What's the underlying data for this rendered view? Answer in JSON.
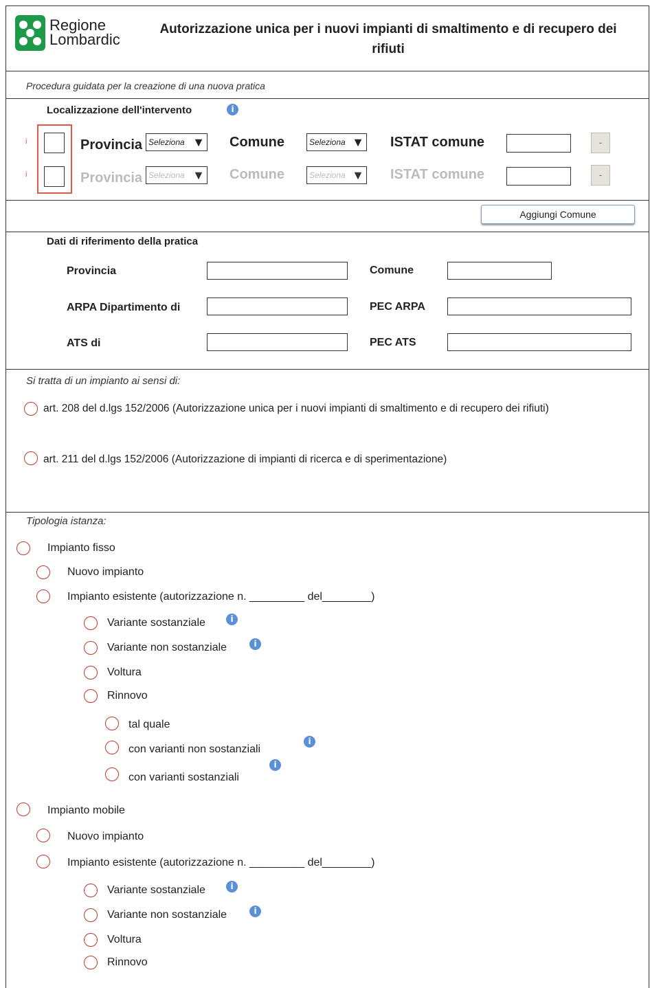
{
  "header": {
    "logo_line1": "Regione",
    "logo_line2": "Lombardic",
    "title_line1": "Autorizzazione unica per i nuovi impianti di smaltimento e di recupero dei",
    "title_line2": "rifiuti"
  },
  "subtitle": "Procedura guidata per la creazione di una nuova pratica",
  "localizzazione": {
    "heading": "Localizzazione dell'intervento",
    "info_icon": "i",
    "rows": [
      {
        "marker": "i",
        "provincia_label": "Provincia",
        "provincia_select": "Seleziona",
        "comune_label": "Comune",
        "comune_select": "Seleziona",
        "istat_label": "ISTAT comune",
        "remove": "-"
      },
      {
        "marker": "i",
        "provincia_label": "Provincia",
        "provincia_select": "Seleziona",
        "comune_label": "Comune",
        "comune_select": "Seleziona",
        "istat_label": "ISTAT comune",
        "remove": "-"
      }
    ],
    "add_button": "Aggiungi Comune"
  },
  "riferimento": {
    "heading": "Dati di riferimento della pratica",
    "provincia": "Provincia",
    "comune": "Comune",
    "arpa": "ARPA Dipartimento di",
    "pec_arpa": "PEC ARPA",
    "ats": "ATS di",
    "pec_ats": "PEC ATS"
  },
  "impianto": {
    "heading": "Si tratta di un impianto ai sensi di:",
    "opt1": "art. 208 del d.lgs 152/2006 (Autorizzazione unica per i nuovi impianti di smaltimento e di recupero dei rifiuti)",
    "opt2": "art. 211 del d.lgs 152/2006 (Autorizzazione di impianti di ricerca e di sperimentazione)"
  },
  "tipologia": {
    "heading": "Tipologia istanza:",
    "fisso": "Impianto fisso",
    "mobile": "Impianto  mobile",
    "nuovo": "Nuovo impianto",
    "esistente": "Impianto esistente (autorizzazione n. _________ del________)",
    "var_sost": "Variante sostanziale",
    "var_non_sost": "Variante non sostanziale",
    "voltura": "Voltura",
    "rinnovo": "Rinnovo",
    "tal_quale": "tal quale",
    "con_var_non": "con varianti non sostanziali",
    "con_var": "con varianti sostanziali"
  }
}
